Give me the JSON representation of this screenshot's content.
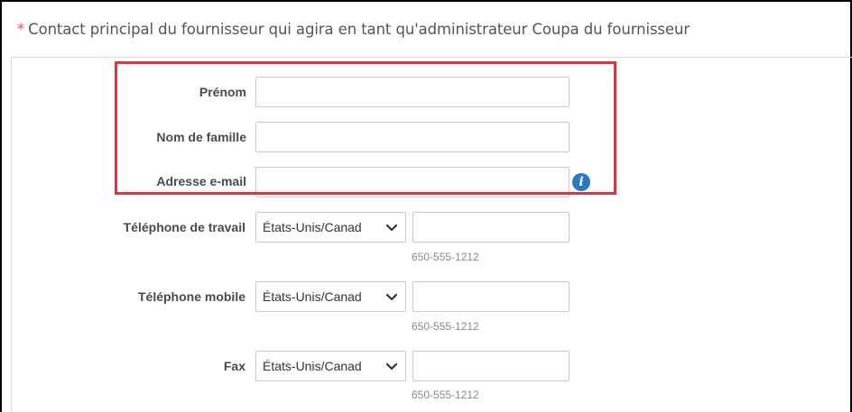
{
  "section": {
    "required_marker": "*",
    "title": "Contact principal du fournisseur qui agira en tant qu'administrateur Coupa du fournisseur"
  },
  "fields": {
    "first_name": {
      "label": "Prénom",
      "value": ""
    },
    "last_name": {
      "label": "Nom de famille",
      "value": ""
    },
    "email": {
      "label": "Adresse e-mail",
      "value": "",
      "info_icon": "info-icon",
      "info_glyph": "i"
    }
  },
  "phones": {
    "work": {
      "label": "Téléphone de travail",
      "country": "États-Unis/Canad",
      "number": "",
      "hint": "650-555-1212"
    },
    "mobile": {
      "label": "Téléphone mobile",
      "country": "États-Unis/Canad",
      "number": "",
      "hint": "650-555-1212"
    },
    "fax": {
      "label": "Fax",
      "country": "États-Unis/Canad",
      "number": "",
      "hint": "650-555-1212"
    }
  },
  "colors": {
    "highlight": "#e0353f",
    "required_marker": "#e8534f",
    "info_icon": "#2a79c2"
  }
}
